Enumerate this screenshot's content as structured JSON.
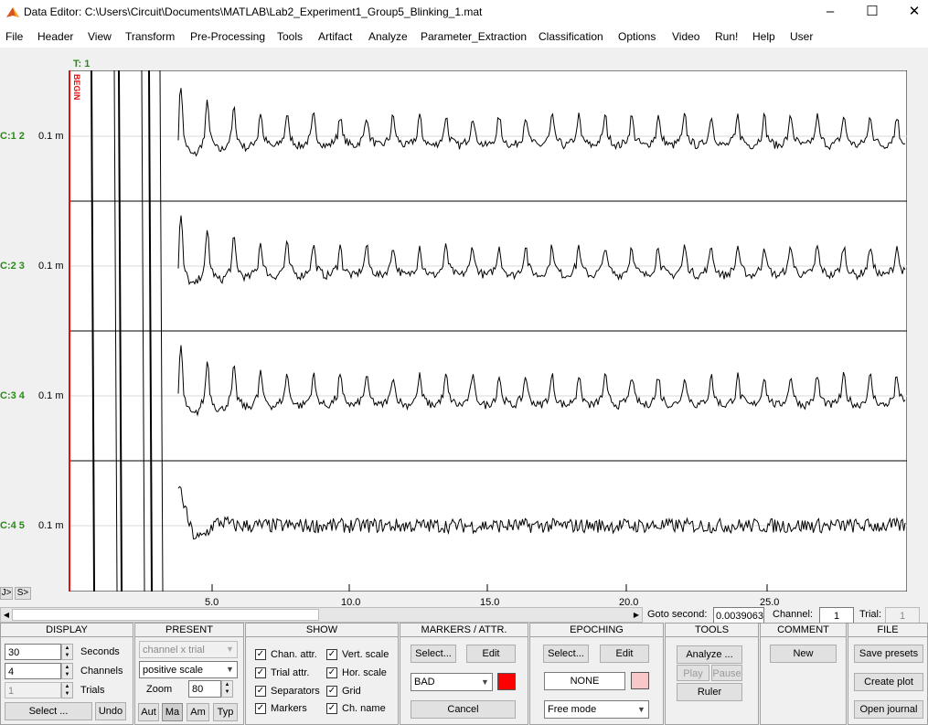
{
  "window": {
    "title": "Data Editor: C:\\Users\\Circuit\\Documents\\MATLAB\\Lab2_Experiment1_Group5_Blinking_1.mat",
    "minimize_icon": "minimize-icon",
    "maximize_icon": "maximize-icon",
    "close_icon": "close-icon"
  },
  "menu": [
    "File",
    "Header",
    "View",
    "Transform",
    "Pre-Processing",
    "Tools",
    "Artifact",
    "Analyze",
    "Parameter_Extraction",
    "Classification",
    "Options",
    "Video",
    "Run!",
    "Help",
    "User"
  ],
  "plot": {
    "trial_label": "T: 1",
    "marker_label": "BEGIN",
    "channels": [
      {
        "name": "C:1 2",
        "scale": "0.1 m"
      },
      {
        "name": "C:2 3",
        "scale": "0.1 m"
      },
      {
        "name": "C:3 4",
        "scale": "0.1 m"
      },
      {
        "name": "C:4 5",
        "scale": "0.1 m"
      }
    ],
    "x_ticks": [
      "5.0",
      "10.0",
      "15.0",
      "20.0",
      "25.0"
    ],
    "nav_left": "J>",
    "nav_right": "S>",
    "trace_color": "#000000",
    "marker_color": "#e01010",
    "label_color": "#2a8a1a"
  },
  "navigation": {
    "goto_label": "Goto second:",
    "goto_value": "0.0039063",
    "channel_label": "Channel:",
    "channel_value": "1",
    "trial_label": "Trial:",
    "trial_value": "1"
  },
  "display": {
    "header": "DISPLAY",
    "seconds_value": "30",
    "seconds_label": "Seconds",
    "channels_value": "4",
    "channels_label": "Channels",
    "trials_value": "1",
    "trials_label": "Trials",
    "select_label": "Select ...",
    "undo_label": "Undo"
  },
  "present": {
    "header": "PRESENT",
    "mode_value": "channel x trial",
    "scale_value": "positive scale",
    "zoom_label": "Zoom",
    "zoom_value": "80",
    "buttons": [
      "Aut",
      "Ma",
      "Am",
      "Typ"
    ]
  },
  "show": {
    "header": "SHOW",
    "left": [
      "Chan. attr.",
      "Trial attr.",
      "Separators",
      "Markers"
    ],
    "right": [
      "Vert. scale",
      "Hor. scale",
      "Grid",
      "Ch. name"
    ],
    "check_mark": "✓"
  },
  "markers": {
    "header": "MARKERS / ATTR.",
    "select_label": "Select...",
    "edit_label": "Edit",
    "attr_value": "BAD",
    "attr_color": "#ff0000",
    "cancel_label": "Cancel"
  },
  "epoching": {
    "header": "EPOCHING",
    "select_label": "Select...",
    "edit_label": "Edit",
    "epoch_value": "NONE",
    "epoch_color": "#f8c8c8",
    "mode_value": "Free mode"
  },
  "tools": {
    "header": "TOOLS",
    "analyze_label": "Analyze ...",
    "play_label": "Play",
    "pause_label": "Pause",
    "ruler_label": "Ruler"
  },
  "comment": {
    "header": "COMMENT",
    "new_label": "New"
  },
  "file": {
    "header": "FILE",
    "save_label": "Save presets",
    "create_label": "Create plot",
    "open_label": "Open journal"
  }
}
